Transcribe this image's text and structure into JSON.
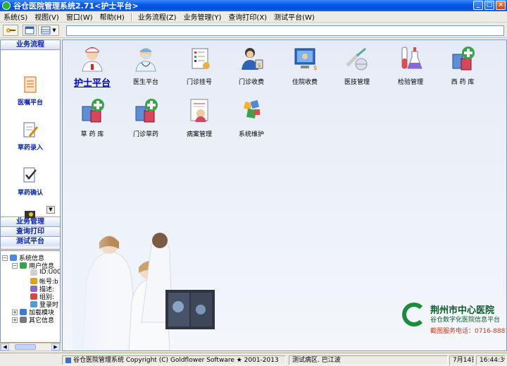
{
  "window": {
    "title": "谷仓医院管理系统2.71<护士平台>"
  },
  "menu": [
    "系统(S)",
    "视图(V)",
    "窗口(W)",
    "帮助(H)",
    "业务流程(Z)",
    "业务管理(Y)",
    "查询打印(X)",
    "测试平台(W)"
  ],
  "left_panel": {
    "header": "业务流程",
    "items": [
      "医嘱平台",
      "草药录入",
      "草药确认"
    ],
    "footers": [
      "业务管理",
      "查询打印",
      "测试平台"
    ]
  },
  "tree": {
    "nodes": [
      "系统信息",
      "用户信息",
      "ID:U00",
      "帐号:b",
      "描述:",
      "组别:",
      "登录时",
      "加载模块",
      "其它信息"
    ]
  },
  "modules": [
    {
      "label": "护士平台",
      "icon": "nurse-icon"
    },
    {
      "label": "医生平台",
      "icon": "doctor-icon"
    },
    {
      "label": "门诊挂号",
      "icon": "registration-icon"
    },
    {
      "label": "门诊收费",
      "icon": "cashier-icon"
    },
    {
      "label": "住院收费",
      "icon": "inpatient-billing-icon"
    },
    {
      "label": "医技管理",
      "icon": "medical-tech-icon"
    },
    {
      "label": "检验管理",
      "icon": "lab-icon"
    },
    {
      "label": "西  药  库",
      "icon": "western-pharmacy-icon"
    },
    {
      "label": "草  药  库",
      "icon": "herbal-pharmacy-icon"
    },
    {
      "label": "门诊草药",
      "icon": "outpatient-herbal-icon"
    },
    {
      "label": "病案管理",
      "icon": "medical-records-icon"
    },
    {
      "label": "系统维护",
      "icon": "system-maintenance-icon"
    }
  ],
  "branding": {
    "name": "荆州市中心医院",
    "subtitle": "谷仓数字化医院信息平台",
    "phone": "截图服务电话：0716-8881888"
  },
  "status": {
    "copyright": "谷仓医院管理系统 Copyright (C) Goldflower Software ★ 2001-2013",
    "ward": "测试病区. 巴江波",
    "date": "7月14日",
    "time": "16:44:39"
  },
  "colors": {
    "titlebar": "#0a5ae8",
    "nav_text": "#0a24a8",
    "active_module": "#0000cc",
    "brand_green": "#1a8d3a"
  }
}
